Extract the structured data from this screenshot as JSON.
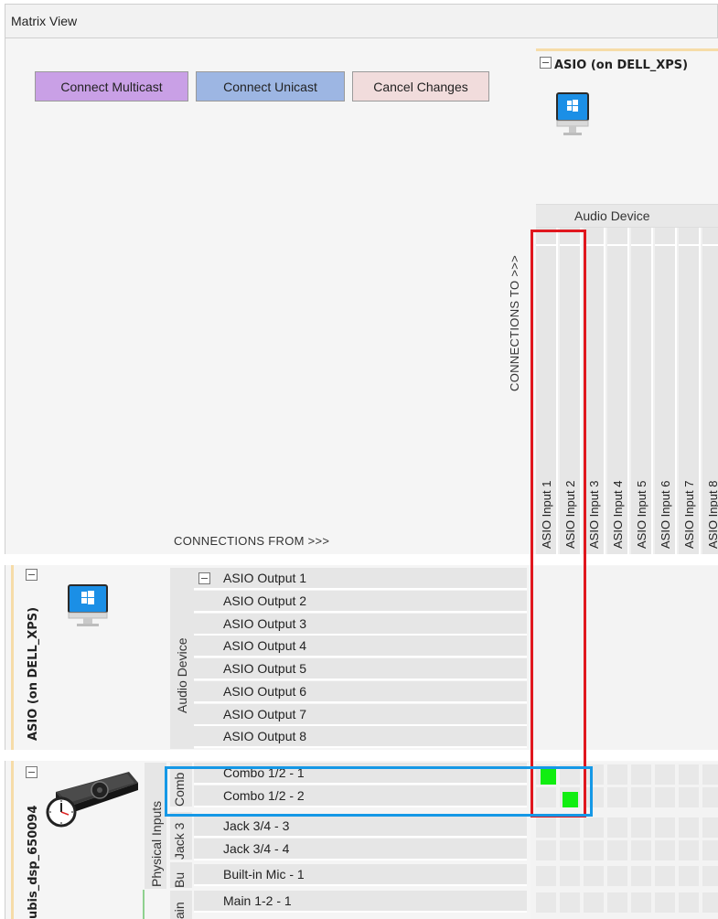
{
  "window": {
    "title": "Matrix View"
  },
  "toolbar": {
    "connect_multicast": "Connect Multicast",
    "connect_unicast": "Connect Unicast",
    "cancel_changes": "Cancel Changes"
  },
  "labels": {
    "connections_to": "CONNECTIONS TO >>>",
    "connections_from": "CONNECTIONS FROM >>>"
  },
  "columns": {
    "device_name": "ASIO (on DELL_XPS)",
    "group": "Audio Device",
    "channels": [
      "ASIO Input 1",
      "ASIO Input 2",
      "ASIO Input 3",
      "ASIO Input 4",
      "ASIO Input 5",
      "ASIO Input 6",
      "ASIO Input 7",
      "ASIO Input 8"
    ]
  },
  "rows": {
    "device1": {
      "name": "ASIO (on DELL_XPS)",
      "group": "Audio Device",
      "channels": [
        "ASIO Output 1",
        "ASIO Output 2",
        "ASIO Output 3",
        "ASIO Output 4",
        "ASIO Output 5",
        "ASIO Output 6",
        "ASIO Output 7",
        "ASIO Output 8"
      ]
    },
    "device2": {
      "name": "ubis_dsp_650094",
      "group": "Physical Inputs",
      "subgroups": [
        "Comb",
        "Jack 3",
        "Bu",
        "ain"
      ],
      "channels": [
        "Combo 1/2 - 1",
        "Combo 1/2 - 2",
        "Jack 3/4 - 3",
        "Jack 3/4 - 4",
        "Built-in Mic - 1",
        "Main 1-2 - 1"
      ]
    }
  },
  "connections": [
    {
      "from": "Combo 1/2 - 1",
      "to": "ASIO Input 1"
    },
    {
      "from": "Combo 1/2 - 2",
      "to": "ASIO Input 2"
    }
  ],
  "colors": {
    "multicast": "#c9a0e6",
    "unicast": "#9db6e3",
    "cancel": "#f1dcdc",
    "connection": "#11ee11",
    "highlight_red": "#e0171e",
    "highlight_blue": "#1598e6"
  }
}
